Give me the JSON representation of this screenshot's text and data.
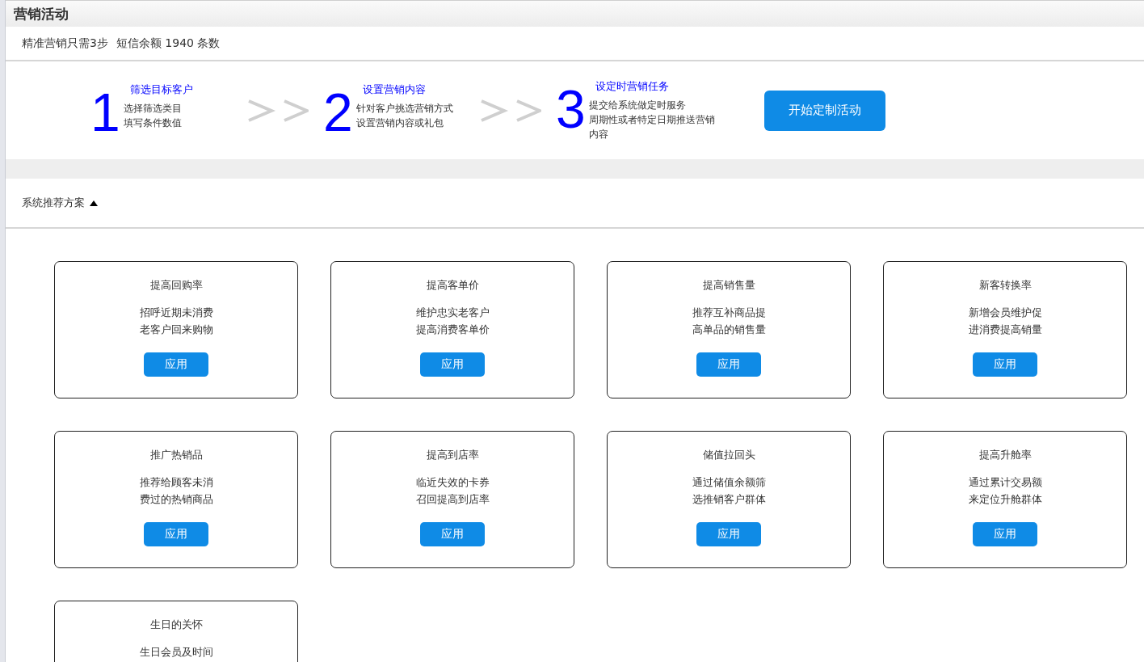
{
  "window": {
    "title": "营销活动"
  },
  "summary": {
    "steps_note": "精准营销只需3步",
    "sms_balance": "短信余额 1940 条数"
  },
  "steps": [
    {
      "number": "1",
      "title": "筛选目标客户",
      "lines": [
        "选择筛选类目",
        "填写条件数值"
      ]
    },
    {
      "number": "2",
      "title": "设置营销内容",
      "lines": [
        "针对客户挑选营销方式",
        "设置营销内容或礼包"
      ]
    },
    {
      "number": "3",
      "title": "设定时营销任务",
      "lines": [
        "提交给系统做定时服务",
        "周期性或者特定日期推送营销内容"
      ]
    }
  ],
  "start_button": "开始定制活动",
  "section": {
    "title": "系统推荐方案",
    "expanded": true
  },
  "plans": [
    {
      "title": "提高回购率",
      "lines": [
        "招呼近期未消费",
        "老客户回来购物"
      ],
      "button": "应用"
    },
    {
      "title": "提高客单价",
      "lines": [
        "维护忠实老客户",
        "提高消费客单价"
      ],
      "button": "应用"
    },
    {
      "title": "提高销售量",
      "lines": [
        "推荐互补商品提",
        "高单品的销售量"
      ],
      "button": "应用"
    },
    {
      "title": "新客转换率",
      "lines": [
        "新增会员维护促",
        "进消费提高销量"
      ],
      "button": "应用"
    },
    {
      "title": "推广热销品",
      "lines": [
        "推荐给顾客未消",
        "费过的热销商品"
      ],
      "button": "应用"
    },
    {
      "title": "提高到店率",
      "lines": [
        "临近失效的卡券",
        "召回提高到店率"
      ],
      "button": "应用"
    },
    {
      "title": "储值拉回头",
      "lines": [
        "通过储值余额筛",
        "选推销客户群体"
      ],
      "button": "应用"
    },
    {
      "title": "提高升舱率",
      "lines": [
        "通过累计交易额",
        "来定位升舱群体"
      ],
      "button": "应用"
    },
    {
      "title": "生日的关怀",
      "lines": [
        "生日会员及时间"
      ]
    }
  ]
}
